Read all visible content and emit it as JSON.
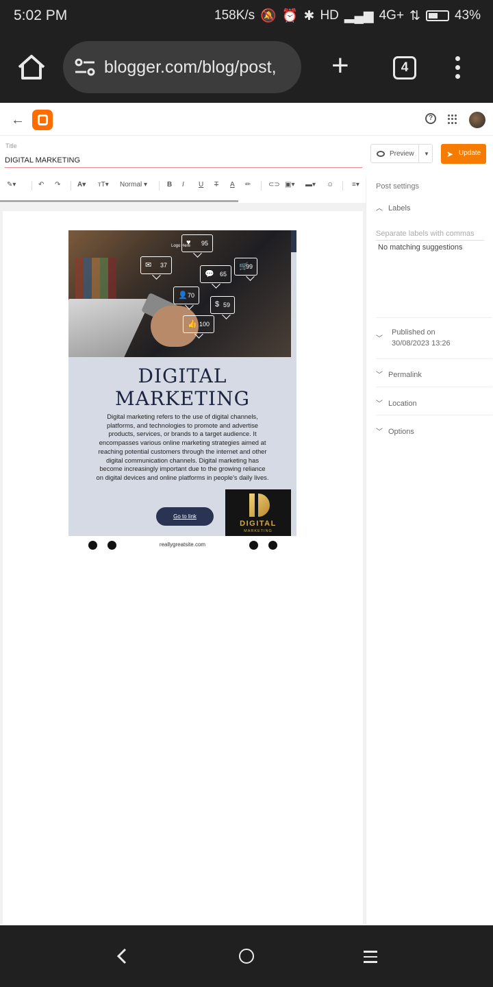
{
  "statusbar": {
    "time": "5:02 PM",
    "speed": "158K/s",
    "network": "HD",
    "signal": "4G+",
    "battery": "43%"
  },
  "browser": {
    "url": "blogger.com/blog/post,",
    "tab_count": "4"
  },
  "editor": {
    "title_label": "Title",
    "title_value": "DIGITAL MARKETING",
    "preview_label": "Preview",
    "update_label": "Update",
    "format_label": "Normal"
  },
  "post": {
    "logo_text": "Logo Here",
    "heading_line1": "DIGITAL",
    "heading_line2": "MARKETING",
    "body": "Digital marketing refers to the use of digital channels, platforms, and technologies to promote and advertise products, services, or brands to a target audience. It encompasses various online marketing strategies aimed at reaching potential customers through the internet and other digital communication channels. Digital marketing has become increasingly important due to the growing reliance on digital devices and online platforms in people's daily lives.",
    "button_label": "Go to link",
    "brand_name": "DIGITAL",
    "brand_sub": "MARKETING",
    "website": "reallygreatsite.com",
    "bubbles": {
      "mail": "37",
      "heart": "95",
      "comment": "65",
      "cart": "99",
      "user": "70",
      "dollar": "59",
      "like": "100"
    }
  },
  "settings": {
    "heading": "Post settings",
    "labels_title": "Labels",
    "labels_placeholder": "Separate labels with commas",
    "no_match": "No matching suggestions",
    "published_label": "Published on",
    "published_value": "30/08/2023 13:26",
    "permalink": "Permalink",
    "location": "Location",
    "options": "Options"
  },
  "colors": {
    "accent": "#f57c00",
    "brand": "#ff6d00",
    "poster_bg": "#d6dae4",
    "heading": "#1c2540"
  }
}
